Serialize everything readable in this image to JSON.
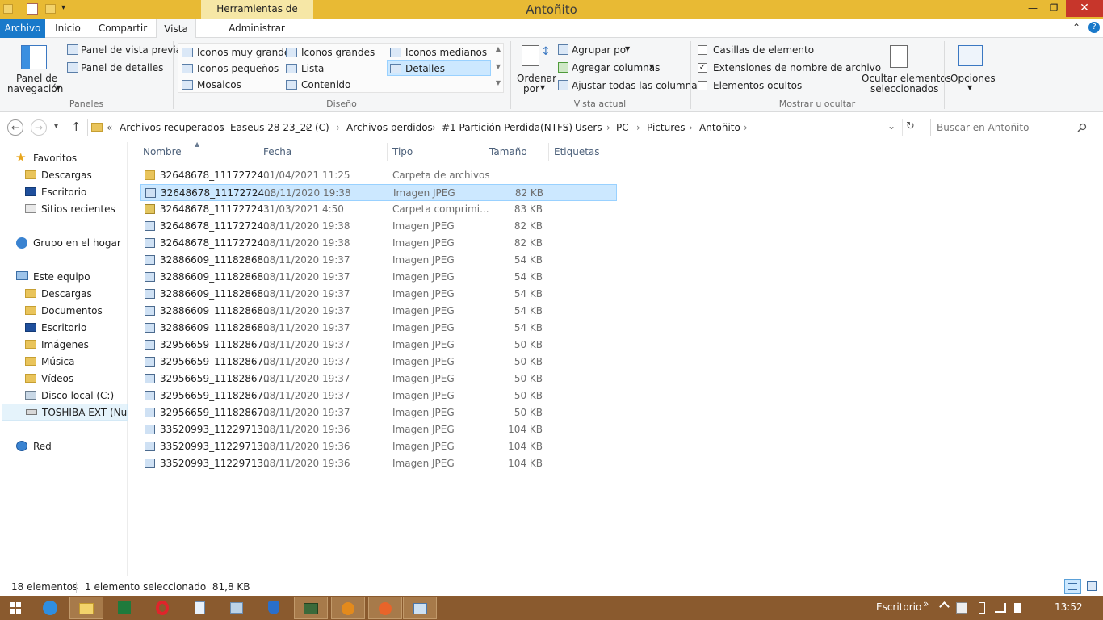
{
  "window": {
    "title": "Antoñito",
    "context_tab": "Herramientas de imagen"
  },
  "quick_access": {
    "dropdown": "▾"
  },
  "window_buttons": {
    "minimize": "—",
    "maximize": "❐",
    "close": "✕"
  },
  "tabs": [
    {
      "label": "Archivo"
    },
    {
      "label": "Inicio"
    },
    {
      "label": "Compartir"
    },
    {
      "label": "Vista"
    },
    {
      "label": "Administrar"
    }
  ],
  "ribbon": {
    "collapse": "⌃",
    "help": "?",
    "panes": {
      "nav_pane_label1": "Panel de",
      "nav_pane_label2": "navegación",
      "preview": "Panel de vista previa",
      "details": "Panel de detalles",
      "group": "Paneles"
    },
    "layout": {
      "items": [
        "Iconos muy grandes",
        "Iconos grandes",
        "Iconos medianos",
        "Iconos pequeños",
        "Lista",
        "Detalles",
        "Mosaicos",
        "Contenido"
      ],
      "selected": "Detalles",
      "group": "Diseño"
    },
    "current_view": {
      "sort1": "Ordenar",
      "sort2": "por",
      "group_by": "Agrupar por",
      "add_columns": "Agregar columnas",
      "fit_columns": "Ajustar todas las columnas",
      "group": "Vista actual"
    },
    "show_hide": {
      "item_checkboxes": "Casillas de elemento",
      "item_checkboxes_checked": false,
      "extensions": "Extensiones de nombre de archivo",
      "extensions_checked": true,
      "hidden": "Elementos ocultos",
      "hidden_checked": false,
      "hide_selected1": "Ocultar elementos",
      "hide_selected2": "seleccionados",
      "group": "Mostrar u ocultar"
    },
    "options": "Opciones"
  },
  "address": {
    "back": "←",
    "forward": "→",
    "recent": "▾",
    "up": "↑",
    "overflow": "«",
    "crumbs": [
      "Archivos recuperados",
      "Easeus 28 23_22",
      "(C)",
      "Archivos perdidos",
      "#1 Partición Perdida(NTFS)",
      "Users",
      "PC",
      "Pictures",
      "Antoñito"
    ],
    "sep": "›",
    "history_dropdown": "⌄",
    "refresh": "↻",
    "search_placeholder": "Buscar en Antoñito"
  },
  "nav_pane": {
    "favorites": "Favoritos",
    "fav_items": [
      "Descargas",
      "Escritorio",
      "Sitios recientes"
    ],
    "homegroup": "Grupo en el hogar",
    "this_pc": "Este equipo",
    "pc_items": [
      "Descargas",
      "Documentos",
      "Escritorio",
      "Imágenes",
      "Música",
      "Vídeos",
      "Disco local (C:)",
      "TOSHIBA EXT (Nuer"
    ],
    "network": "Red"
  },
  "columns": {
    "name": "Nombre",
    "date": "Fecha",
    "type": "Tipo",
    "size": "Tamaño",
    "tags": "Etiquetas"
  },
  "files": [
    {
      "name": "32648678_11172724...",
      "date": "01/04/2021 11:25",
      "type": "Carpeta de archivos",
      "size": "",
      "kind": "folder"
    },
    {
      "name": "32648678_11172724...",
      "date": "08/11/2020 19:38",
      "type": "Imagen JPEG",
      "size": "82 KB",
      "kind": "img"
    },
    {
      "name": "32648678_11172724...",
      "date": "31/03/2021 4:50",
      "type": "Carpeta comprimi...",
      "size": "83 KB",
      "kind": "zip"
    },
    {
      "name": "32648678_11172724...",
      "date": "08/11/2020 19:38",
      "type": "Imagen JPEG",
      "size": "82 KB",
      "kind": "img"
    },
    {
      "name": "32648678_11172724...",
      "date": "08/11/2020 19:38",
      "type": "Imagen JPEG",
      "size": "82 KB",
      "kind": "img"
    },
    {
      "name": "32886609_11182868...",
      "date": "08/11/2020 19:37",
      "type": "Imagen JPEG",
      "size": "54 KB",
      "kind": "img"
    },
    {
      "name": "32886609_11182868...",
      "date": "08/11/2020 19:37",
      "type": "Imagen JPEG",
      "size": "54 KB",
      "kind": "img"
    },
    {
      "name": "32886609_11182868...",
      "date": "08/11/2020 19:37",
      "type": "Imagen JPEG",
      "size": "54 KB",
      "kind": "img"
    },
    {
      "name": "32886609_11182868...",
      "date": "08/11/2020 19:37",
      "type": "Imagen JPEG",
      "size": "54 KB",
      "kind": "img"
    },
    {
      "name": "32886609_11182868...",
      "date": "08/11/2020 19:37",
      "type": "Imagen JPEG",
      "size": "54 KB",
      "kind": "img"
    },
    {
      "name": "32956659_11182867...",
      "date": "08/11/2020 19:37",
      "type": "Imagen JPEG",
      "size": "50 KB",
      "kind": "img"
    },
    {
      "name": "32956659_11182867...",
      "date": "08/11/2020 19:37",
      "type": "Imagen JPEG",
      "size": "50 KB",
      "kind": "img"
    },
    {
      "name": "32956659_11182867...",
      "date": "08/11/2020 19:37",
      "type": "Imagen JPEG",
      "size": "50 KB",
      "kind": "img"
    },
    {
      "name": "32956659_11182867...",
      "date": "08/11/2020 19:37",
      "type": "Imagen JPEG",
      "size": "50 KB",
      "kind": "img"
    },
    {
      "name": "32956659_11182867...",
      "date": "08/11/2020 19:37",
      "type": "Imagen JPEG",
      "size": "50 KB",
      "kind": "img"
    },
    {
      "name": "33520993_11229713...",
      "date": "08/11/2020 19:36",
      "type": "Imagen JPEG",
      "size": "104 KB",
      "kind": "img"
    },
    {
      "name": "33520993_11229713...",
      "date": "08/11/2020 19:36",
      "type": "Imagen JPEG",
      "size": "104 KB",
      "kind": "img"
    },
    {
      "name": "33520993_11229713...",
      "date": "08/11/2020 19:36",
      "type": "Imagen JPEG",
      "size": "104 KB",
      "kind": "img"
    }
  ],
  "selected_index": 1,
  "status": {
    "count": "18 elementos",
    "selection": "1 elemento seleccionado  81,8 KB"
  },
  "taskbar": {
    "desktop_label": "Escritorio",
    "clock": "13:52",
    "overflow": "»"
  }
}
